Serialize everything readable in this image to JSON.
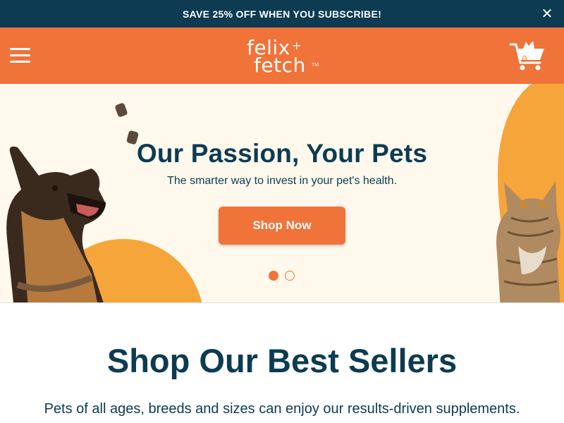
{
  "promo": {
    "text": "SAVE 25% OFF WHEN YOU SUBSCRIBE!",
    "close_icon": "close-icon"
  },
  "header": {
    "menu_icon": "hamburger-menu-icon",
    "logo": {
      "line1": "felix",
      "plus": "+",
      "line2": "fetch",
      "tm": "TM"
    },
    "cart": {
      "icon": "shopping-cart-icon",
      "count": "0"
    }
  },
  "hero": {
    "title": "Our Passion, Your Pets",
    "subtitle": "The smarter way to invest in your pet's health.",
    "cta_label": "Shop Now",
    "slides": {
      "total": 2,
      "active": 1
    }
  },
  "best_sellers": {
    "title": "Shop Our Best Sellers",
    "subtitle": "Pets of all ages, breeds and sizes can enjoy our results-driven supplements."
  },
  "colors": {
    "navy": "#0c3b52",
    "orange": "#f0733a",
    "amber": "#f6a53a",
    "cream": "#fef9ec"
  }
}
